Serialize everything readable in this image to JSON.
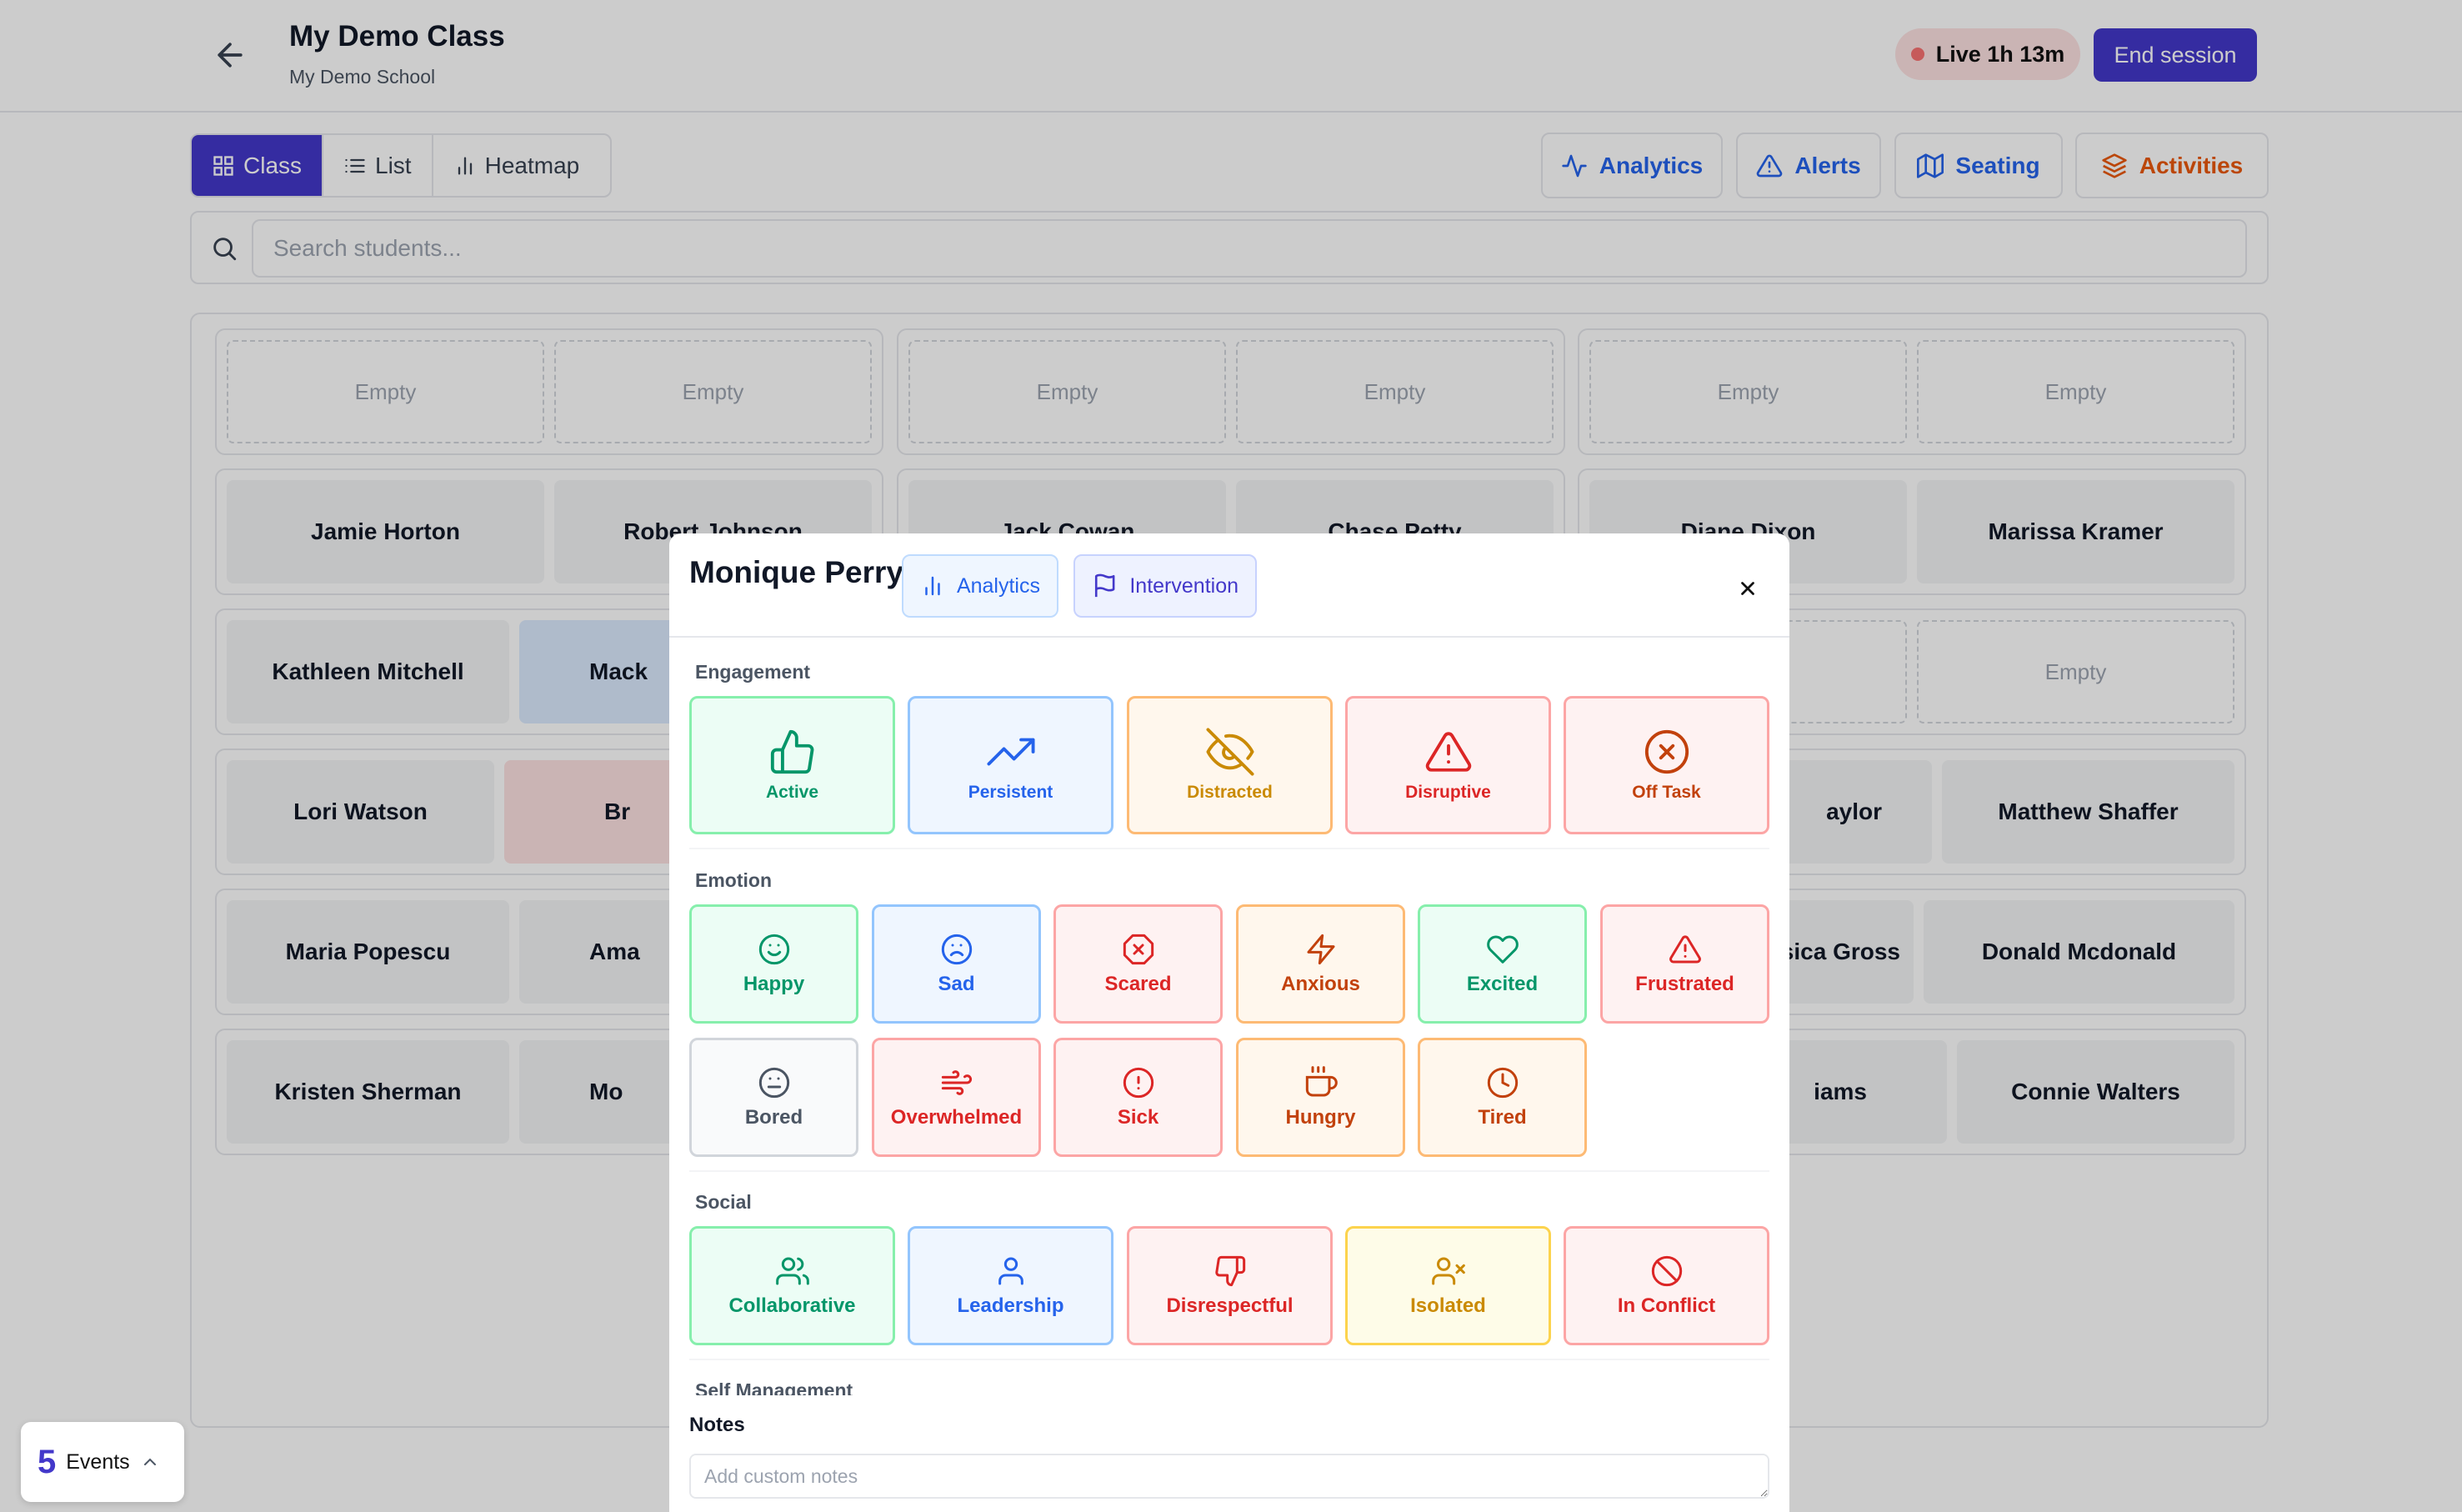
{
  "header": {
    "title": "My Demo Class",
    "subtitle": "My Demo School",
    "live_label": "Live 1h 13m",
    "end_session_label": "End session"
  },
  "view_tabs": [
    {
      "label": "Class",
      "icon": "grid-icon",
      "active": true
    },
    {
      "label": "List",
      "icon": "list-icon",
      "active": false
    },
    {
      "label": "Heatmap",
      "icon": "bar-chart-icon",
      "active": false
    }
  ],
  "tools": [
    {
      "label": "Analytics",
      "icon": "activity-icon",
      "color": "#2563eb"
    },
    {
      "label": "Alerts",
      "icon": "alert-triangle-icon",
      "color": "#2563eb"
    },
    {
      "label": "Seating",
      "icon": "map-icon",
      "color": "#2563eb"
    },
    {
      "label": "Activities",
      "icon": "layers-icon",
      "color": "#ea580c"
    }
  ],
  "search": {
    "placeholder": "Search students..."
  },
  "desks": [
    {
      "seats": [
        {
          "name": "Empty",
          "empty": true
        },
        {
          "name": "Empty",
          "empty": true
        }
      ]
    },
    {
      "seats": [
        {
          "name": "Empty",
          "empty": true
        },
        {
          "name": "Empty",
          "empty": true
        }
      ]
    },
    {
      "seats": [
        {
          "name": "Empty",
          "empty": true
        },
        {
          "name": "Empty",
          "empty": true
        }
      ]
    },
    {
      "seats": [
        {
          "name": "Jamie Horton"
        },
        {
          "name": "Robert Johnson"
        }
      ]
    },
    {
      "seats": [
        {
          "name": "Jack Cowan"
        },
        {
          "name": "Chase Petty"
        }
      ]
    },
    {
      "seats": [
        {
          "name": "Diane Dixon"
        },
        {
          "name": "Marissa Kramer"
        }
      ]
    },
    {
      "seats": [
        {
          "name": "Kathleen Mitchell"
        },
        {
          "name": "Mack",
          "state": "blue"
        }
      ]
    },
    {
      "seats": [
        {
          "name": "",
          "empty": false
        },
        {
          "name": ""
        }
      ]
    },
    {
      "seats": [
        {
          "name": "",
          "empty": true
        },
        {
          "name": "Empty",
          "empty": true
        }
      ]
    },
    {
      "seats": [
        {
          "name": "Lori Watson"
        },
        {
          "name": "Br",
          "state": "red"
        }
      ]
    },
    {
      "seats": [
        {
          "name": ""
        },
        {
          "name": ""
        }
      ]
    },
    {
      "seats": [
        {
          "name": "aylor"
        },
        {
          "name": "Matthew Shaffer"
        }
      ]
    },
    {
      "seats": [
        {
          "name": "Maria Popescu"
        },
        {
          "name": "Ama"
        }
      ]
    },
    {
      "seats": [
        {
          "name": ""
        },
        {
          "name": ""
        }
      ]
    },
    {
      "seats": [
        {
          "name": "sica Gross"
        },
        {
          "name": "Donald Mcdonald"
        }
      ]
    },
    {
      "seats": [
        {
          "name": "Kristen Sherman"
        },
        {
          "name": "Mo"
        }
      ]
    },
    {
      "seats": [
        {
          "name": ""
        },
        {
          "name": ""
        }
      ]
    },
    {
      "seats": [
        {
          "name": "iams"
        },
        {
          "name": "Connie Walters"
        }
      ]
    }
  ],
  "modal": {
    "student_name": "Monique Perry",
    "tab_analytics": "Analytics",
    "tab_intervention": "Intervention",
    "sections": {
      "engagement": "Engagement",
      "emotion": "Emotion",
      "social": "Social",
      "self_management": "Self Management"
    },
    "engagement": [
      {
        "label": "Active",
        "icon": "thumbs-up-icon",
        "color": "green"
      },
      {
        "label": "Persistent",
        "icon": "trending-up-icon",
        "color": "blue"
      },
      {
        "label": "Distracted",
        "icon": "eye-off-icon",
        "color": "orange"
      },
      {
        "label": "Disruptive",
        "icon": "alert-triangle-icon",
        "color": "red"
      },
      {
        "label": "Off Task",
        "icon": "x-circle-icon",
        "color": "red"
      }
    ],
    "emotion": [
      {
        "label": "Happy",
        "icon": "smile-icon",
        "color": "green"
      },
      {
        "label": "Sad",
        "icon": "frown-icon",
        "color": "blue"
      },
      {
        "label": "Scared",
        "icon": "x-octagon-icon",
        "color": "red"
      },
      {
        "label": "Anxious",
        "icon": "zap-icon",
        "color": "amber"
      },
      {
        "label": "Excited",
        "icon": "heart-icon",
        "color": "green"
      },
      {
        "label": "Frustrated",
        "icon": "alert-triangle-icon",
        "color": "red"
      },
      {
        "label": "Bored",
        "icon": "meh-icon",
        "color": "gray"
      },
      {
        "label": "Overwhelmed",
        "icon": "wind-icon",
        "color": "red"
      },
      {
        "label": "Sick",
        "icon": "alert-circle-icon",
        "color": "red"
      },
      {
        "label": "Hungry",
        "icon": "coffee-icon",
        "color": "amber"
      },
      {
        "label": "Tired",
        "icon": "clock-icon",
        "color": "amber"
      }
    ],
    "social": [
      {
        "label": "Collaborative",
        "icon": "users-icon",
        "color": "green"
      },
      {
        "label": "Leadership",
        "icon": "user-icon",
        "color": "blue"
      },
      {
        "label": "Disrespectful",
        "icon": "thumbs-down-icon",
        "color": "red"
      },
      {
        "label": "Isolated",
        "icon": "user-x-icon",
        "color": "yellow"
      },
      {
        "label": "In Conflict",
        "icon": "ban-icon",
        "color": "red"
      }
    ],
    "notes_label": "Notes",
    "notes_placeholder": "Add custom notes"
  },
  "events": {
    "count": "5",
    "label": "Events"
  }
}
